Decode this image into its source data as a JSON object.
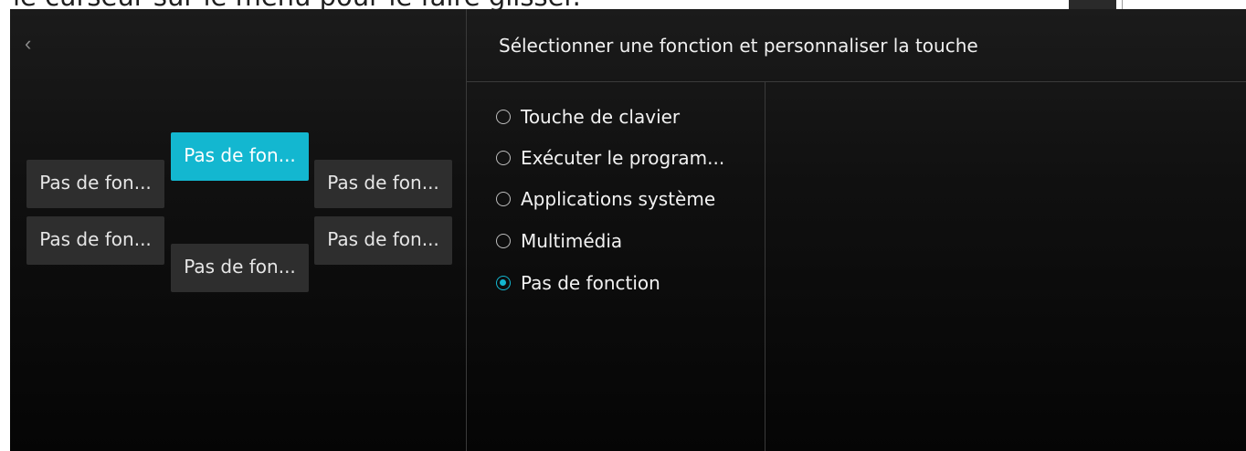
{
  "caption": "le curseur sur le menu pour le faire glisser.",
  "left_panel": {
    "back_icon": "chevron-left-icon",
    "keys": [
      {
        "label": "Pas de fon...",
        "active": true
      },
      {
        "label": "Pas de fon...",
        "active": false
      },
      {
        "label": "Pas de fon...",
        "active": false
      },
      {
        "label": "Pas de fon...",
        "active": false
      },
      {
        "label": "Pas de fon...",
        "active": false
      },
      {
        "label": "Pas de fon...",
        "active": false
      }
    ]
  },
  "right_panel": {
    "title": "Sélectionner une fonction et personnaliser la touche",
    "options": [
      {
        "label": "Touche de clavier",
        "checked": false
      },
      {
        "label": "Exécuter le program...",
        "checked": false
      },
      {
        "label": "Applications système",
        "checked": false
      },
      {
        "label": "Multimédia",
        "checked": false
      },
      {
        "label": "Pas de fonction",
        "checked": true
      }
    ]
  },
  "colors": {
    "accent": "#13b7d0",
    "button_bg": "#2e2e2e",
    "background": "#101010"
  }
}
